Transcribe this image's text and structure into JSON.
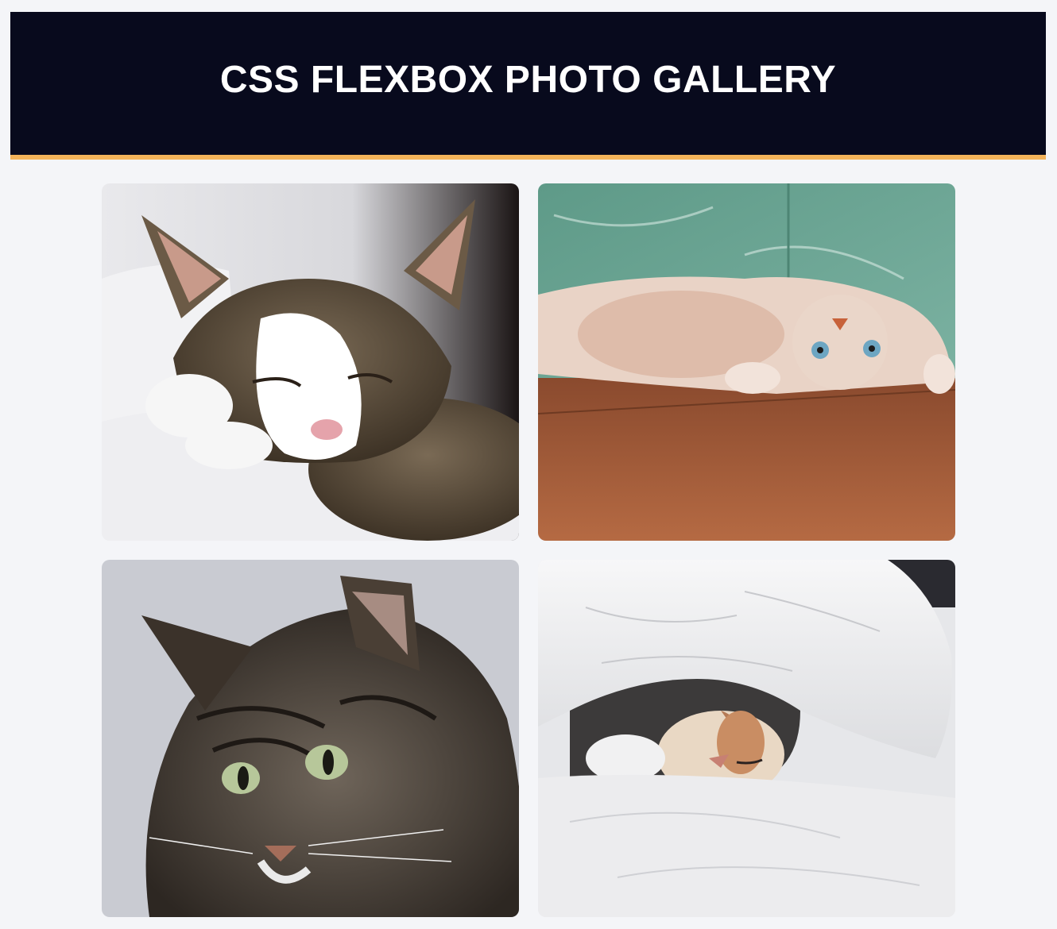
{
  "header": {
    "title": "CSS FLEXBOX PHOTO GALLERY",
    "accent_color": "#f3b35a",
    "background_color": "#080a1d"
  },
  "gallery": {
    "photos": [
      {
        "subject": "tabby-white cat sleeping on white bedsheets"
      },
      {
        "subject": "cream cat lying upside down on wooden floor against green wall"
      },
      {
        "subject": "long-haired tabby cat with green eyes"
      },
      {
        "subject": "cat sleeping under white duvet"
      }
    ]
  }
}
